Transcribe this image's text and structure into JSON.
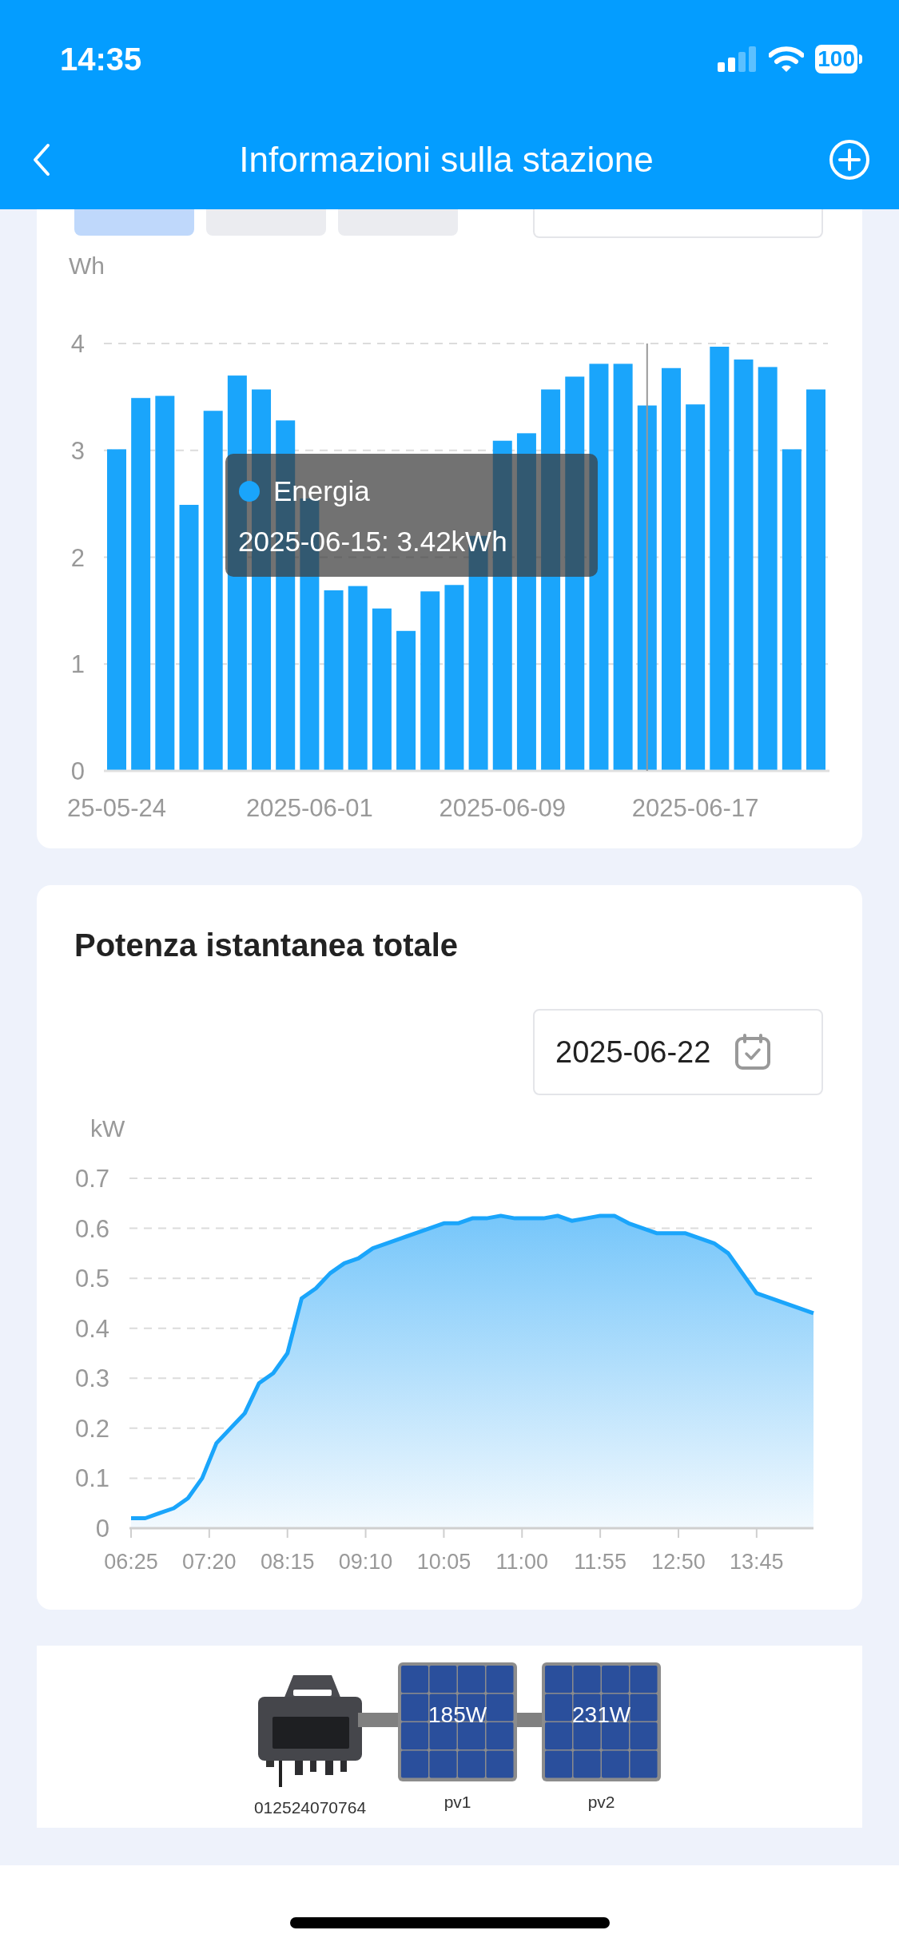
{
  "status_bar": {
    "time": "14:35",
    "battery": "100"
  },
  "header": {
    "title": "Informazioni sulla stazione"
  },
  "energy_card": {
    "tabs": [
      {
        "selected": true
      },
      {
        "selected": false
      },
      {
        "selected": false
      }
    ],
    "chart_data": {
      "type": "bar",
      "ylabel": "Wh",
      "grid": true,
      "categories": [
        "25-05-24",
        null,
        null,
        null,
        null,
        null,
        null,
        null,
        "2025-06-01",
        null,
        null,
        null,
        null,
        null,
        null,
        null,
        "2025-06-09",
        null,
        null,
        null,
        null,
        null,
        null,
        null,
        "2025-06-17",
        null,
        null,
        null,
        null,
        null
      ],
      "series": [
        {
          "name": "Energia",
          "color": "#1aa5fb",
          "values": [
            3.01,
            3.49,
            3.51,
            2.49,
            3.37,
            3.7,
            3.57,
            3.28,
            2.55,
            1.69,
            1.73,
            1.52,
            1.31,
            1.68,
            1.74,
            2.2,
            3.09,
            3.16,
            3.57,
            3.69,
            3.81,
            3.81,
            3.42,
            3.77,
            3.43,
            3.97,
            3.85,
            3.78,
            3.01,
            3.57
          ]
        }
      ],
      "ylim": [
        0,
        4
      ],
      "yticks": [
        0,
        1,
        2,
        3,
        4
      ],
      "annotations": [
        "2025-06-15: 3.42kWh"
      ]
    }
  },
  "power_card": {
    "title": "Potenza istantanea totale",
    "date": "2025-06-22",
    "chart_data": {
      "type": "area",
      "ylabel": "kW",
      "grid": true,
      "x": [
        385,
        395,
        405,
        415,
        425,
        435,
        445,
        455,
        465,
        475,
        485,
        495,
        505,
        515,
        525,
        535,
        545,
        555,
        565,
        575,
        585,
        595,
        605,
        615,
        625,
        635,
        645,
        655,
        665,
        675,
        685,
        695,
        705,
        715,
        725,
        735,
        745,
        755,
        765,
        775,
        785,
        795,
        805,
        815,
        825,
        835,
        845,
        855,
        865
      ],
      "series": [
        {
          "color": "#1aa5fb",
          "values": [
            0.02,
            0.02,
            0.03,
            0.04,
            0.06,
            0.1,
            0.17,
            0.2,
            0.23,
            0.29,
            0.31,
            0.35,
            0.46,
            0.48,
            0.51,
            0.53,
            0.54,
            0.56,
            0.57,
            0.58,
            0.59,
            0.6,
            0.61,
            0.61,
            0.62,
            0.62,
            0.625,
            0.62,
            0.62,
            0.62,
            0.625,
            0.615,
            0.62,
            0.625,
            0.625,
            0.61,
            0.6,
            0.59,
            0.59,
            0.59,
            0.58,
            0.57,
            0.55,
            0.51,
            0.47,
            0.46,
            0.45,
            0.44,
            0.43
          ]
        }
      ],
      "xlim": [
        385,
        865
      ],
      "ylim": [
        0,
        0.7
      ],
      "yticks": [
        0,
        0.1,
        0.2,
        0.3,
        0.4,
        0.5,
        0.6,
        0.7
      ],
      "xticks": [
        {
          "value": 385,
          "label": "06:25"
        },
        {
          "value": 440,
          "label": "07:20"
        },
        {
          "value": 495,
          "label": "08:15"
        },
        {
          "value": 550,
          "label": "09:10"
        },
        {
          "value": 605,
          "label": "10:05"
        },
        {
          "value": 660,
          "label": "11:00"
        },
        {
          "value": 715,
          "label": "11:55"
        },
        {
          "value": 770,
          "label": "12:50"
        },
        {
          "value": 825,
          "label": "13:45"
        }
      ]
    }
  },
  "device": {
    "inverter": {
      "kind": "picture",
      "serial": "012524070764"
    },
    "panels": [
      {
        "name": "pv1",
        "power": "185W"
      },
      {
        "name": "pv2",
        "power": "231W"
      }
    ]
  }
}
